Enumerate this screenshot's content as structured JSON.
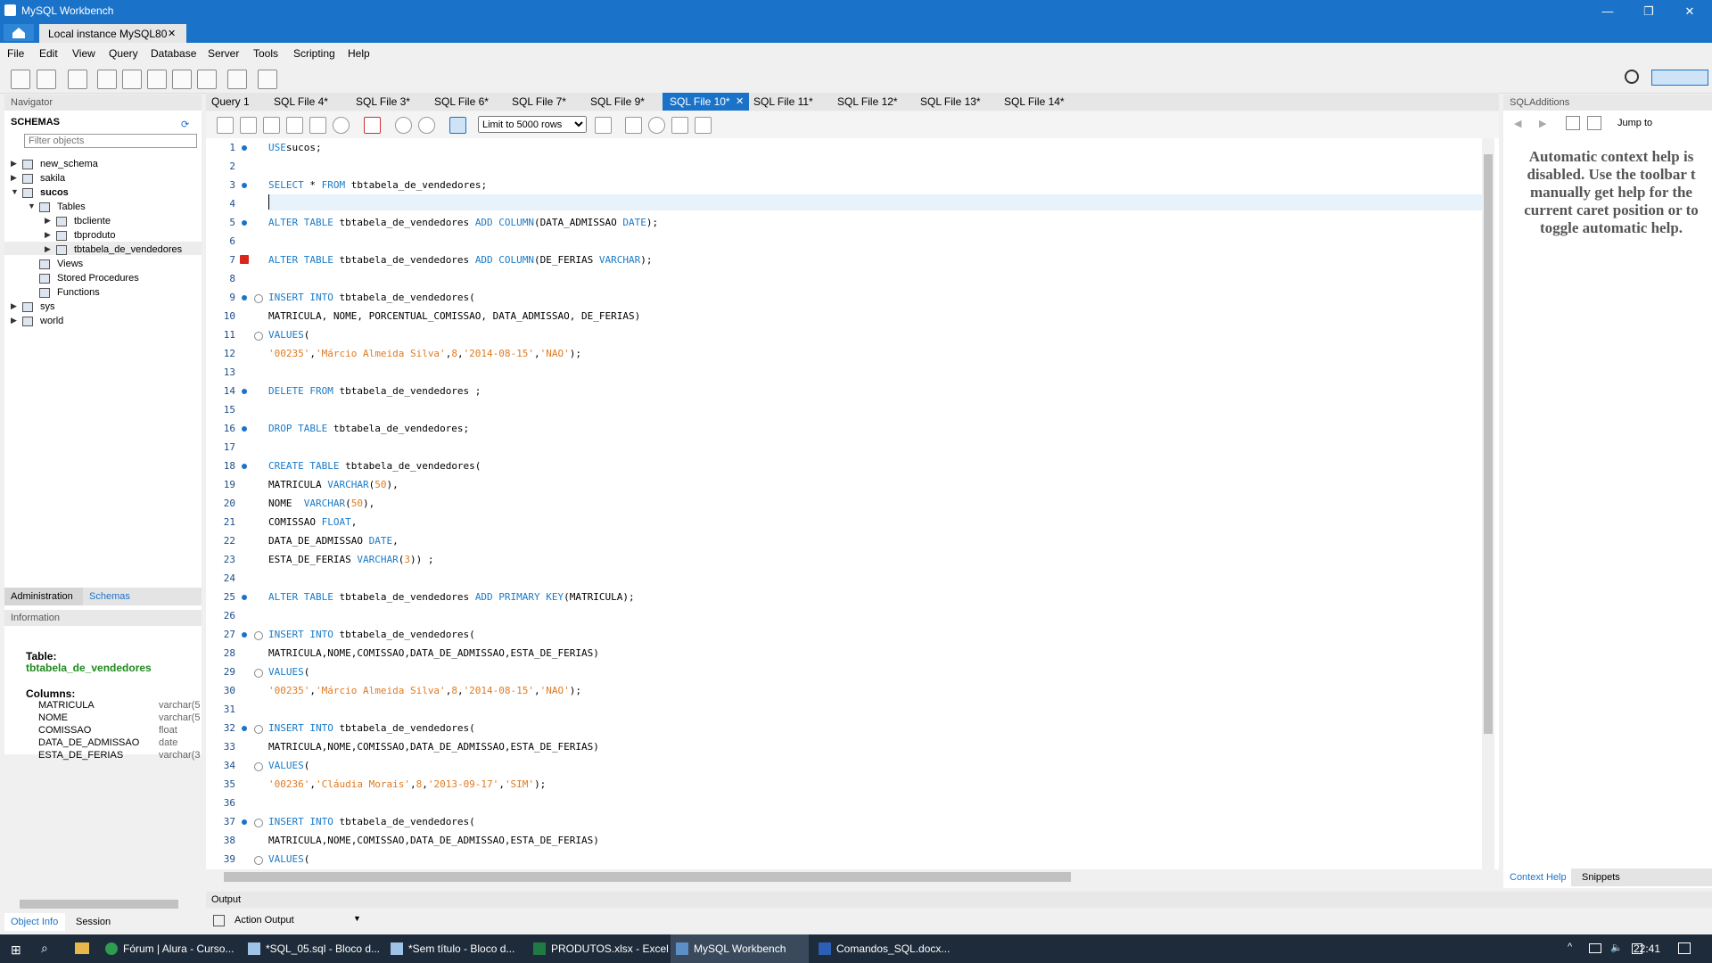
{
  "window": {
    "title": "MySQL Workbench",
    "connection_tab": "Local instance MySQL80",
    "min": "—",
    "restore": "❐",
    "close": "✕",
    "close_tab": "✕"
  },
  "menu": [
    "File",
    "Edit",
    "View",
    "Query",
    "Database",
    "Server",
    "Tools",
    "Scripting",
    "Help"
  ],
  "navigator": {
    "header": "Navigator",
    "schemas_label": "SCHEMAS",
    "filter_placeholder": "Filter objects",
    "tree": [
      "new_schema",
      "sakila",
      "sucos",
      "Tables",
      "tbcliente",
      "tbproduto",
      "tbtabela_de_vendedores",
      "Views",
      "Stored Procedures",
      "Functions",
      "sys",
      "world"
    ],
    "tabs": [
      "Administration",
      "Schemas"
    ]
  },
  "information": {
    "header": "Information",
    "table_label": "Table:",
    "table_name": "tbtabela_de_vendedores",
    "columns_label": "Columns:",
    "columns": [
      [
        "MATRICULA",
        "varchar(5"
      ],
      [
        "NOME",
        "varchar(5"
      ],
      [
        "COMISSAO",
        "float"
      ],
      [
        "DATA_DE_ADMISSAO",
        "date"
      ],
      [
        "ESTA_DE_FERIAS",
        "varchar(3"
      ]
    ]
  },
  "bottom_tabs": [
    "Object Info",
    "Session"
  ],
  "query_tabs": [
    "Query 1",
    "SQL File 4*",
    "SQL File 3*",
    "SQL File 6*",
    "SQL File 7*",
    "SQL File 9*",
    "SQL File 10*",
    "SQL File 11*",
    "SQL File 12*",
    "SQL File 13*",
    "SQL File 14*"
  ],
  "active_tab": "SQL File 10*",
  "limit": "Limit to 5000 rows",
  "code_lines": [
    [
      [
        "kw",
        "USE"
      ],
      [
        "",
        "sucos;"
      ]
    ],
    [],
    [
      [
        "kw",
        "SELECT"
      ],
      [
        "",
        " * "
      ],
      [
        "kw",
        "FROM"
      ],
      [
        "",
        " tbtabela_de_vendedores;"
      ]
    ],
    [],
    [
      [
        "kw",
        "ALTER TABLE"
      ],
      [
        "",
        " tbtabela_de_vendedores "
      ],
      [
        "kw",
        "ADD COLUMN"
      ],
      [
        "",
        "(DATA_ADMISSAO "
      ],
      [
        "kw",
        "DATE"
      ],
      [
        "",
        ");"
      ]
    ],
    [],
    [
      [
        "kw",
        "ALTER TABLE"
      ],
      [
        "",
        " tbtabela_de_vendedores "
      ],
      [
        "kw",
        "ADD COLUMN"
      ],
      [
        "",
        "(DE_FERIAS "
      ],
      [
        "kw",
        "VARCHAR"
      ],
      [
        "",
        ");"
      ]
    ],
    [],
    [
      [
        "kw",
        "INSERT INTO"
      ],
      [
        "",
        " tbtabela_de_vendedores("
      ]
    ],
    [
      [
        "",
        "MATRICULA, NOME, PORCENTUAL_COMISSAO, DATA_ADMISSAO, DE_FERIAS)"
      ]
    ],
    [
      [
        "kw",
        "VALUES"
      ],
      [
        "",
        "("
      ]
    ],
    [
      [
        "st",
        "'00235'"
      ],
      [
        "",
        ","
      ],
      [
        "st",
        "'Márcio Almeida Silva'"
      ],
      [
        "",
        ","
      ],
      [
        "nm",
        "8"
      ],
      [
        "",
        ","
      ],
      [
        "st",
        "'2014-08-15'"
      ],
      [
        "",
        ","
      ],
      [
        "st",
        "'NAO'"
      ],
      [
        "",
        ");"
      ]
    ],
    [],
    [
      [
        "kw",
        "DELETE FROM"
      ],
      [
        "",
        " tbtabela_de_vendedores ;"
      ]
    ],
    [],
    [
      [
        "kw",
        "DROP TABLE"
      ],
      [
        "",
        " tbtabela_de_vendedores;"
      ]
    ],
    [],
    [
      [
        "kw",
        "CREATE TABLE"
      ],
      [
        "",
        " tbtabela_de_vendedores("
      ]
    ],
    [
      [
        "",
        "MATRICULA "
      ],
      [
        "kw",
        "VARCHAR"
      ],
      [
        "",
        "("
      ],
      [
        "nm",
        "50"
      ],
      [
        "",
        "),"
      ]
    ],
    [
      [
        "",
        "NOME  "
      ],
      [
        "kw",
        "VARCHAR"
      ],
      [
        "",
        "("
      ],
      [
        "nm",
        "50"
      ],
      [
        "",
        "),"
      ]
    ],
    [
      [
        "",
        "COMISSAO "
      ],
      [
        "kw",
        "FLOAT"
      ],
      [
        "",
        ","
      ]
    ],
    [
      [
        "",
        "DATA_DE_ADMISSAO "
      ],
      [
        "kw",
        "DATE"
      ],
      [
        "",
        ","
      ]
    ],
    [
      [
        "",
        "ESTA_DE_FERIAS "
      ],
      [
        "kw",
        "VARCHAR"
      ],
      [
        "",
        "("
      ],
      [
        "nm",
        "3"
      ],
      [
        "",
        ")) ;"
      ]
    ],
    [],
    [
      [
        "kw",
        "ALTER TABLE"
      ],
      [
        "",
        " tbtabela_de_vendedores "
      ],
      [
        "kw",
        "ADD PRIMARY KEY"
      ],
      [
        "",
        "(MATRICULA);"
      ]
    ],
    [],
    [
      [
        "kw",
        "INSERT INTO"
      ],
      [
        "",
        " tbtabela_de_vendedores("
      ]
    ],
    [
      [
        "",
        "MATRICULA,NOME,COMISSAO,DATA_DE_ADMISSAO,ESTA_DE_FERIAS)"
      ]
    ],
    [
      [
        "kw",
        "VALUES"
      ],
      [
        "",
        "("
      ]
    ],
    [
      [
        "st",
        "'00235'"
      ],
      [
        "",
        ","
      ],
      [
        "st",
        "'Márcio Almeida Silva'"
      ],
      [
        "",
        ","
      ],
      [
        "nm",
        "8"
      ],
      [
        "",
        ","
      ],
      [
        "st",
        "'2014-08-15'"
      ],
      [
        "",
        ","
      ],
      [
        "st",
        "'NAO'"
      ],
      [
        "",
        ");"
      ]
    ],
    [],
    [
      [
        "kw",
        "INSERT INTO"
      ],
      [
        "",
        " tbtabela_de_vendedores("
      ]
    ],
    [
      [
        "",
        "MATRICULA,NOME,COMISSAO,DATA_DE_ADMISSAO,ESTA_DE_FERIAS)"
      ]
    ],
    [
      [
        "kw",
        "VALUES"
      ],
      [
        "",
        "("
      ]
    ],
    [
      [
        "st",
        "'00236'"
      ],
      [
        "",
        ","
      ],
      [
        "st",
        "'Cláudia Morais'"
      ],
      [
        "",
        ","
      ],
      [
        "nm",
        "8"
      ],
      [
        "",
        ","
      ],
      [
        "st",
        "'2013-09-17'"
      ],
      [
        "",
        ","
      ],
      [
        "st",
        "'SIM'"
      ],
      [
        "",
        ");"
      ]
    ],
    [],
    [
      [
        "kw",
        "INSERT INTO"
      ],
      [
        "",
        " tbtabela_de_vendedores("
      ]
    ],
    [
      [
        "",
        "MATRICULA,NOME,COMISSAO,DATA_DE_ADMISSAO,ESTA_DE_FERIAS)"
      ]
    ],
    [
      [
        "kw",
        "VALUES"
      ],
      [
        "",
        "("
      ]
    ]
  ],
  "sql_additions": {
    "header": "SQLAdditions",
    "jump_to": "Jump to",
    "help": "Automatic context help is disabled. Use the toolbar t manually get help for the current caret position or to toggle automatic help.",
    "tabs": [
      "Context Help",
      "Snippets"
    ]
  },
  "output": {
    "header": "Output",
    "selector": "Action Output"
  },
  "taskbar": {
    "apps": [
      "Fórum | Alura - Curso...",
      "*SQL_05.sql - Bloco d...",
      "*Sem título - Bloco d...",
      "PRODUTOS.xlsx - Excel",
      "MySQL Workbench",
      "Comandos_SQL.docx..."
    ],
    "time": "22:41"
  }
}
